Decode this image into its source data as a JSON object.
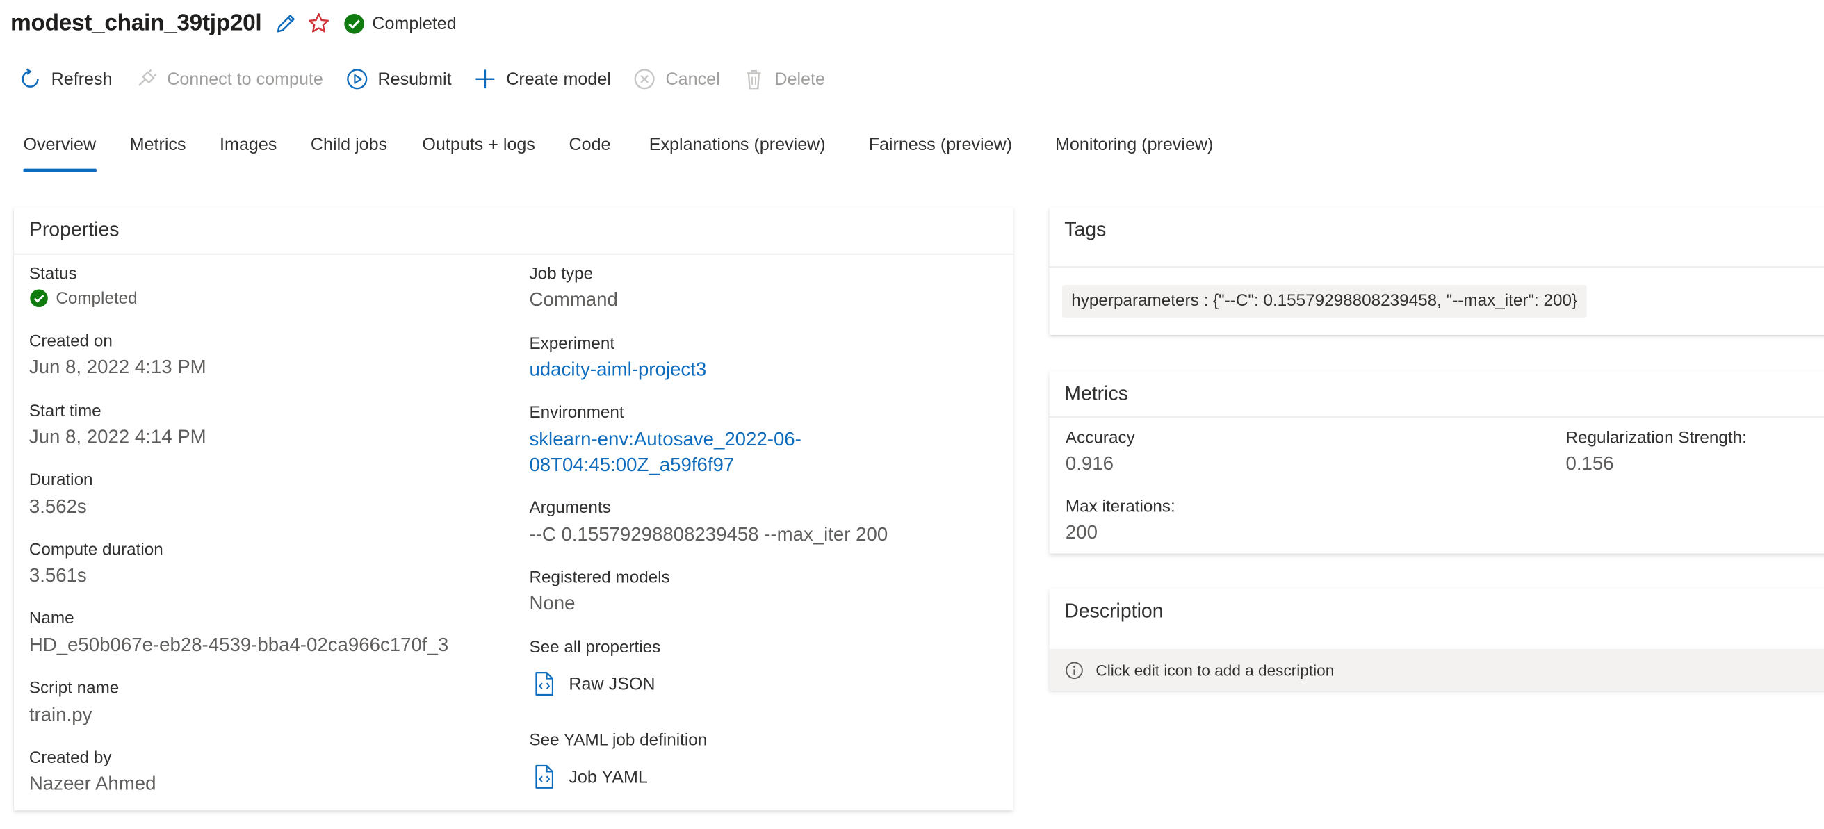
{
  "header": {
    "job_name": "modest_chain_39tjp20l",
    "status": "Completed"
  },
  "toolbar": {
    "refresh": "Refresh",
    "connect": "Connect to compute",
    "resubmit": "Resubmit",
    "create_model": "Create model",
    "cancel": "Cancel",
    "delete": "Delete"
  },
  "tabs": [
    {
      "label": "Overview"
    },
    {
      "label": "Metrics"
    },
    {
      "label": "Images"
    },
    {
      "label": "Child jobs"
    },
    {
      "label": "Outputs + logs"
    },
    {
      "label": "Code"
    },
    {
      "label": "Explanations (preview)"
    },
    {
      "label": "Fairness (preview)"
    },
    {
      "label": "Monitoring (preview)"
    }
  ],
  "properties": {
    "title": "Properties",
    "status_label": "Status",
    "status_value": "Completed",
    "created_on_label": "Created on",
    "created_on_value": "Jun 8, 2022 4:13 PM",
    "start_time_label": "Start time",
    "start_time_value": "Jun 8, 2022 4:14 PM",
    "duration_label": "Duration",
    "duration_value": "3.562s",
    "compute_duration_label": "Compute duration",
    "compute_duration_value": "3.561s",
    "name_label": "Name",
    "name_value": "HD_e50b067e-eb28-4539-bba4-02ca966c170f_3",
    "script_label": "Script name",
    "script_value": "train.py",
    "created_by_label": "Created by",
    "created_by_value": "Nazeer Ahmed",
    "job_type_label": "Job type",
    "job_type_value": "Command",
    "experiment_label": "Experiment",
    "experiment_value": "udacity-aiml-project3",
    "environment_label": "Environment",
    "environment_line1": "sklearn-env:Autosave_2022-06-",
    "environment_line2": "08T04:45:00Z_a59f6f97",
    "arguments_label": "Arguments",
    "arguments_value": "--C 0.15579298808239458 --max_iter 200",
    "registered_label": "Registered models",
    "registered_value": "None",
    "see_all_label": "See all properties",
    "raw_json": "Raw JSON",
    "see_yaml_label": "See YAML job definition",
    "job_yaml": "Job YAML"
  },
  "tags": {
    "title": "Tags",
    "items": [
      "hyperparameters : {\"--C\": 0.15579298808239458, \"--max_iter\": 200}"
    ]
  },
  "metrics": {
    "title": "Metrics",
    "accuracy_label": "Accuracy",
    "accuracy_value": "0.916",
    "reg_label": "Regularization Strength:",
    "reg_value": "0.156",
    "max_iter_label": "Max iterations:",
    "max_iter_value": "200"
  },
  "description": {
    "title": "Description",
    "placeholder": "Click edit icon to add a description"
  },
  "colors": {
    "accent": "#0f6cbd",
    "success": "#107c10",
    "favorite": "#d13438",
    "disabled": "#a19f9d"
  },
  "icons": {
    "edit": "pencil-icon",
    "favorite": "star-icon",
    "status": "check-circle-icon",
    "refresh": "refresh-icon",
    "connect": "plug-icon",
    "resubmit": "play-circle-icon",
    "create_model": "plus-icon",
    "cancel": "cancel-circle-icon",
    "delete": "trash-icon",
    "file": "code-file-icon",
    "info": "info-icon"
  }
}
